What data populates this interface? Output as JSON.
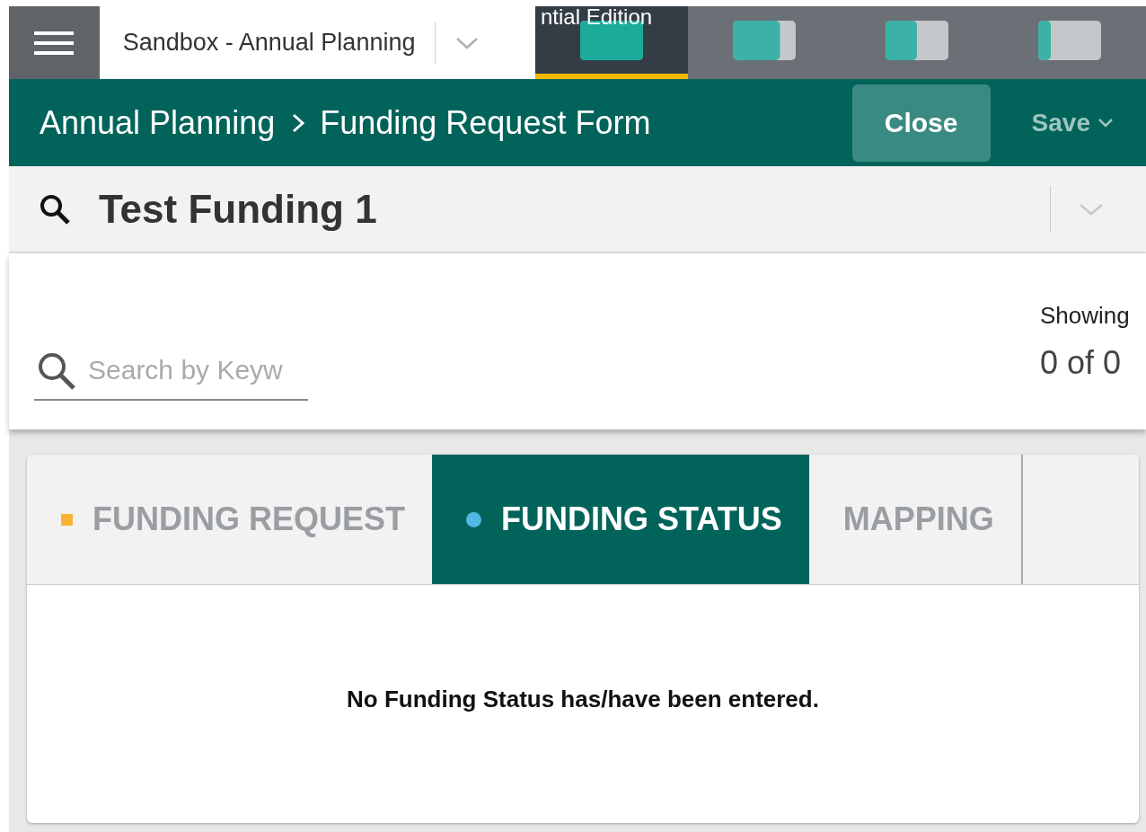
{
  "app_bar": {
    "project": "Sandbox - Annual Planning",
    "edition": "ntial Edition",
    "views": [
      {
        "selected": true
      },
      {
        "selected": false
      },
      {
        "selected": false
      },
      {
        "selected": false
      }
    ]
  },
  "header": {
    "breadcrumb": [
      "Annual Planning",
      "Funding Request Form"
    ],
    "close": "Close",
    "save": "Save"
  },
  "record": {
    "title": "Test Funding 1"
  },
  "search": {
    "placeholder": "Search by Keyw"
  },
  "showing": {
    "label": "Showing",
    "count": "0 of 0"
  },
  "tabs": [
    {
      "label": "FUNDING REQUEST",
      "selected": false,
      "kind": "square",
      "color": "#f9b233"
    },
    {
      "label": "FUNDING STATUS",
      "selected": true,
      "kind": "circle",
      "color": "#4fb9e3"
    },
    {
      "label": "MAPPING",
      "selected": false,
      "kind": "plain"
    }
  ],
  "empty_message": "No Funding Status has/have been entered."
}
